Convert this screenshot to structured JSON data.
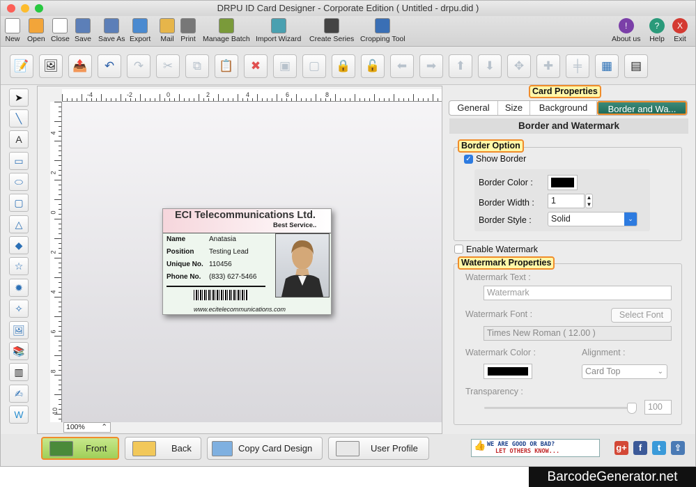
{
  "window": {
    "title": "DRPU ID Card Designer - Corporate Edition ( Untitled - drpu.did )"
  },
  "toolbar": [
    {
      "label": "New",
      "icon": "new-icon"
    },
    {
      "label": "Open",
      "icon": "open-icon"
    },
    {
      "label": "Close",
      "icon": "close-file-icon"
    },
    {
      "label": "Save",
      "icon": "save-icon"
    },
    {
      "label": "Save As",
      "icon": "save-as-icon"
    },
    {
      "label": "Export",
      "icon": "export-icon"
    },
    {
      "label": "Mail",
      "icon": "mail-icon"
    },
    {
      "label": "Print",
      "icon": "print-icon"
    },
    {
      "label": "Manage Batch",
      "icon": "manage-batch-icon"
    },
    {
      "label": "Import Wizard",
      "icon": "import-wizard-icon"
    },
    {
      "label": "Create Series",
      "icon": "create-series-icon"
    },
    {
      "label": "Cropping Tool",
      "icon": "cropping-tool-icon"
    }
  ],
  "toolbar_right": [
    {
      "label": "About us",
      "icon": "about-icon"
    },
    {
      "label": "Help",
      "icon": "help-icon"
    },
    {
      "label": "Exit",
      "icon": "exit-icon"
    }
  ],
  "ruler": {
    "h_ticks": [
      "-4",
      "-2",
      "0",
      "2",
      "4",
      "6",
      "8"
    ],
    "v_ticks": [
      "4",
      "2",
      "0",
      "2",
      "4",
      "6",
      "8",
      "10"
    ]
  },
  "zoom": {
    "value": "100%"
  },
  "card": {
    "company": "ECI Telecommunications Ltd.",
    "tagline": "Best Service..",
    "fields": [
      {
        "label": "Name",
        "value": "Anatasia"
      },
      {
        "label": "Position",
        "value": "Testing Lead"
      },
      {
        "label": "Unique No.",
        "value": "110456"
      },
      {
        "label": "Phone No.",
        "value": "(833) 627-5466"
      }
    ],
    "website": "www.ecitelecommunications.com"
  },
  "panel": {
    "title": "Card Properties",
    "tabs": [
      "General",
      "Size",
      "Background",
      "Border and Wa..."
    ],
    "active_tab": "Border and Wa...",
    "section_title": "Border and Watermark",
    "border_option": {
      "title": "Border Option",
      "show_border_label": "Show Border",
      "show_border_checked": true,
      "color_label": "Border Color :",
      "color": "#000000",
      "width_label": "Border Width :",
      "width": "1",
      "style_label": "Border Style :",
      "style": "Solid"
    },
    "watermark": {
      "enable_label": "Enable Watermark",
      "enabled": false,
      "props_title": "Watermark Properties",
      "text_label": "Watermark Text :",
      "text_placeholder": "Watermark",
      "font_label": "Watermark Font :",
      "select_font": "Select Font",
      "font_value": "Times New Roman ( 12.00 )",
      "color_label": "Watermark Color :",
      "color": "#000000",
      "alignment_label": "Alignment :",
      "alignment": "Card Top",
      "transparency_label": "Transparency :",
      "transparency": "100"
    }
  },
  "bottom": {
    "front": "Front",
    "back": "Back",
    "copy": "Copy Card Design",
    "profile": "User Profile",
    "feedback_line1": "WE ARE GOOD OR BAD?",
    "feedback_line2": "LET OTHERS KNOW..."
  },
  "brand": "BarcodeGenerator.net",
  "colors": {
    "accent_tab": "#2a7a68",
    "highlight": "#fff7a8",
    "highlight_border": "#f08c2a"
  }
}
